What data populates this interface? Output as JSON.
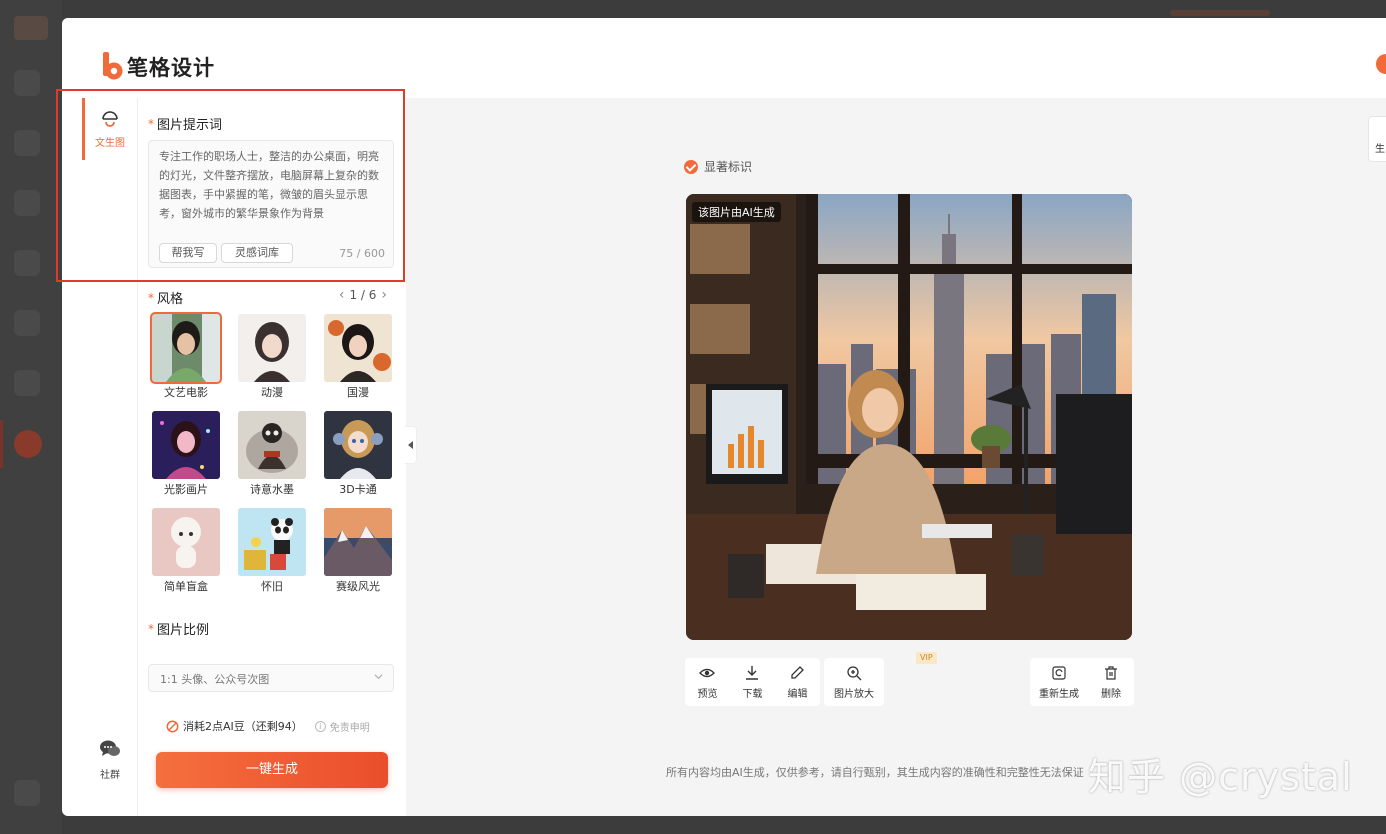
{
  "app": {
    "brand_name": "笔格设计"
  },
  "rail": {
    "text_to_image": "文生图",
    "community": "社群"
  },
  "prompt": {
    "label": "图片提示词",
    "value": "专注工作的职场人士，整洁的办公桌面，明亮的灯光，文件整齐摆放，电脑屏幕上复杂的数据图表，手中紧握的笔，微皱的眉头显示思考，窗外城市的繁华景象作为背景",
    "chip_write": "帮我写",
    "chip_library": "灵感词库",
    "counter": "75 / 600"
  },
  "style": {
    "label": "风格",
    "pager": "1 / 6",
    "items": [
      {
        "name": "文艺电影",
        "selected": true
      },
      {
        "name": "动漫"
      },
      {
        "name": "国漫"
      },
      {
        "name": "光影画片"
      },
      {
        "name": "诗意水墨"
      },
      {
        "name": "3D卡通"
      },
      {
        "name": "简单盲盒"
      },
      {
        "name": "怀旧"
      },
      {
        "name": "赛级风光"
      }
    ]
  },
  "ratio": {
    "label": "图片比例",
    "value": "1:1 头像、公众号次图"
  },
  "cost": {
    "text": "消耗2点AI豆（还剩94）",
    "disclaimer": "免责申明"
  },
  "generate_button": "一键生成",
  "canvas": {
    "watermark_toggle": "显著标识",
    "ai_tag": "该图片由AI生成",
    "tools_left": [
      "预览",
      "下载",
      "编辑"
    ],
    "upscale": "图片放大",
    "vip": "VIP",
    "tools_right": [
      "重新生成",
      "删除"
    ],
    "disclaimer": "所有内容均由AI生成，仅供参考，请自行甄别，其生成内容的准确性和完整性无法保证",
    "right_tab": "生"
  },
  "watermark": "知乎 @crystal",
  "colors": {
    "accent": "#f06a3a",
    "highlight_box": "#e23a2a"
  }
}
